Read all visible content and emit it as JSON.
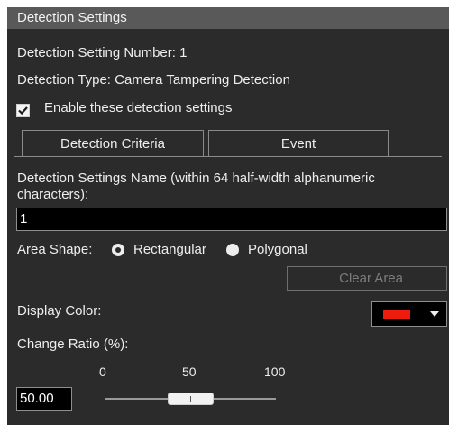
{
  "header": {
    "title": "Detection Settings"
  },
  "detection": {
    "setting_number": "Detection Setting Number: 1",
    "type": "Detection Type: Camera Tampering Detection",
    "enable_label": "Enable these detection settings",
    "enable_checked": true
  },
  "tabs": [
    {
      "label": "Detection Criteria",
      "active": true
    },
    {
      "label": "Event",
      "active": false
    }
  ],
  "name_field": {
    "label_line1": "Detection Settings Name (within 64 half-width alphanumeric",
    "label_line2": "characters):",
    "value": "1"
  },
  "area_shape": {
    "label": "Area Shape:",
    "options": [
      {
        "label": "Rectangular",
        "selected": true
      },
      {
        "label": "Polygonal",
        "selected": false
      }
    ],
    "clear_label": "Clear Area"
  },
  "display_color": {
    "label": "Display Color:",
    "value_color": "#ee1c0c"
  },
  "change_ratio": {
    "label": "Change Ratio (%):",
    "ticks": [
      "0",
      "50",
      "100"
    ],
    "value": "50.00",
    "slider_value": 50
  },
  "colors": {
    "panel_bg": "#2b2b2b",
    "header_bg": "#595959",
    "accent_red": "#ee1c0c"
  }
}
